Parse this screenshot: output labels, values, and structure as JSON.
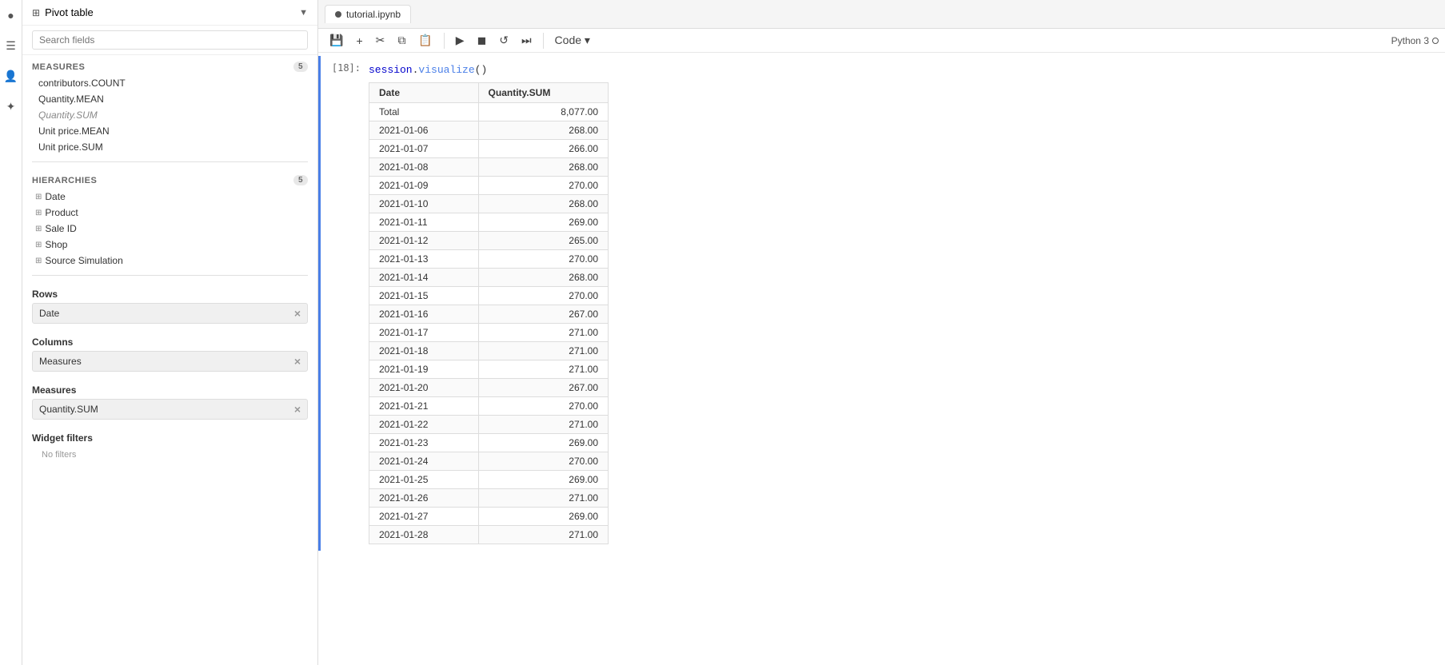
{
  "sidebar": {
    "title": "Pivot table",
    "search_placeholder": "Search fields",
    "measures_label": "MEASURES",
    "measures_count": 5,
    "measures_items": [
      {
        "name": "contributors.COUNT",
        "highlighted": false
      },
      {
        "name": "Quantity.MEAN",
        "highlighted": false
      },
      {
        "name": "Quantity.SUM",
        "highlighted": true
      },
      {
        "name": "Unit price.MEAN",
        "highlighted": false
      },
      {
        "name": "Unit price.SUM",
        "highlighted": false
      }
    ],
    "hierarchies_label": "HIERARCHIES",
    "hierarchies_count": 5,
    "hierarchies_items": [
      {
        "name": "Date"
      },
      {
        "name": "Product"
      },
      {
        "name": "Sale ID"
      },
      {
        "name": "Shop"
      },
      {
        "name": "Source Simulation"
      }
    ],
    "rows_label": "Rows",
    "rows_tag": "Date",
    "columns_label": "Columns",
    "columns_tag": "Measures",
    "measures_section_label": "Measures",
    "measures_tag": "Quantity.SUM",
    "widget_filters_label": "Widget filters",
    "no_filters": "No filters"
  },
  "notebook": {
    "tab_name": "tutorial.ipynb",
    "kernel": "Python 3",
    "cell_number": "[18]:",
    "cell_code": "session.visualize()",
    "table": {
      "headers": [
        "Date",
        "Quantity.SUM"
      ],
      "total_row": [
        "Total",
        "8,077.00"
      ],
      "rows": [
        [
          "2021-01-06",
          "268.00"
        ],
        [
          "2021-01-07",
          "266.00"
        ],
        [
          "2021-01-08",
          "268.00"
        ],
        [
          "2021-01-09",
          "270.00"
        ],
        [
          "2021-01-10",
          "268.00"
        ],
        [
          "2021-01-11",
          "269.00"
        ],
        [
          "2021-01-12",
          "265.00"
        ],
        [
          "2021-01-13",
          "270.00"
        ],
        [
          "2021-01-14",
          "268.00"
        ],
        [
          "2021-01-15",
          "270.00"
        ],
        [
          "2021-01-16",
          "267.00"
        ],
        [
          "2021-01-17",
          "271.00"
        ],
        [
          "2021-01-18",
          "271.00"
        ],
        [
          "2021-01-19",
          "271.00"
        ],
        [
          "2021-01-20",
          "267.00"
        ],
        [
          "2021-01-21",
          "270.00"
        ],
        [
          "2021-01-22",
          "271.00"
        ],
        [
          "2021-01-23",
          "269.00"
        ],
        [
          "2021-01-24",
          "270.00"
        ],
        [
          "2021-01-25",
          "269.00"
        ],
        [
          "2021-01-26",
          "271.00"
        ],
        [
          "2021-01-27",
          "269.00"
        ],
        [
          "2021-01-28",
          "271.00"
        ]
      ]
    }
  },
  "toolbar": {
    "save_icon": "💾",
    "add_icon": "+",
    "cut_icon": "✂",
    "copy_icon": "⧉",
    "paste_icon": "📋",
    "run_icon": "▶",
    "stop_icon": "◼",
    "restart_icon": "↺",
    "fast_forward_icon": "⏭",
    "code_label": "Code"
  }
}
